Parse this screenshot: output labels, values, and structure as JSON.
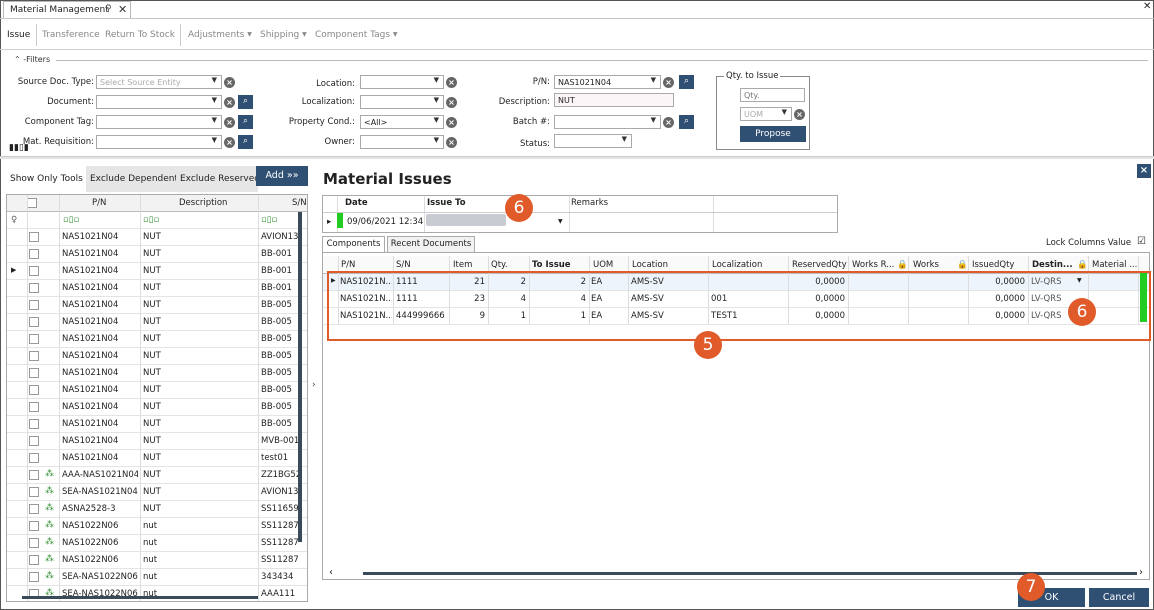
{
  "window": {
    "tab_title": "Material Management",
    "close": "✕"
  },
  "menu": {
    "items": [
      "Issue",
      "Transference",
      "Return To Stock",
      "Adjustments",
      "Shipping",
      "Component Tags"
    ]
  },
  "filters": {
    "legend": "Filters",
    "source_doc_type": {
      "label": "Source Doc. Type:",
      "placeholder": "Select Source Entity"
    },
    "document": {
      "label": "Document:"
    },
    "component_tag": {
      "label": "Component Tag:"
    },
    "mat_requisition": {
      "label": "Mat. Requisition:"
    },
    "location": {
      "label": "Location:"
    },
    "localization": {
      "label": "Localization:"
    },
    "property_cond": {
      "label": "Property Cond.:",
      "value": "<All>"
    },
    "owner": {
      "label": "Owner:"
    },
    "pn": {
      "label": "P/N:",
      "value": "NAS1021N04"
    },
    "description": {
      "label": "Description:",
      "value": "NUT"
    },
    "batch": {
      "label": "Batch #:"
    },
    "status": {
      "label": "Status:"
    },
    "qty_to_issue": {
      "title": "Qty. to Issue",
      "qty_placeholder": "Qty.",
      "uom_placeholder": "UOM",
      "propose": "Propose"
    }
  },
  "left_panel": {
    "tabs": [
      "Show Only Tools",
      "Exclude Dependent",
      "Exclude Reserved"
    ],
    "add_button": "Add »»",
    "columns": [
      "P/N",
      "Description",
      "S/N"
    ],
    "rows": [
      {
        "pn": "NAS1021N04",
        "desc": "NUT",
        "sn": "AVION13",
        "tree": false
      },
      {
        "pn": "NAS1021N04",
        "desc": "NUT",
        "sn": "BB-001",
        "tree": false
      },
      {
        "pn": "NAS1021N04",
        "desc": "NUT",
        "sn": "BB-001",
        "tree": false
      },
      {
        "pn": "NAS1021N04",
        "desc": "NUT",
        "sn": "BB-001",
        "tree": false
      },
      {
        "pn": "NAS1021N04",
        "desc": "NUT",
        "sn": "BB-005",
        "tree": false
      },
      {
        "pn": "NAS1021N04",
        "desc": "NUT",
        "sn": "BB-005",
        "tree": false
      },
      {
        "pn": "NAS1021N04",
        "desc": "NUT",
        "sn": "BB-005",
        "tree": false
      },
      {
        "pn": "NAS1021N04",
        "desc": "NUT",
        "sn": "BB-005",
        "tree": false
      },
      {
        "pn": "NAS1021N04",
        "desc": "NUT",
        "sn": "BB-005",
        "tree": false
      },
      {
        "pn": "NAS1021N04",
        "desc": "NUT",
        "sn": "BB-005",
        "tree": false
      },
      {
        "pn": "NAS1021N04",
        "desc": "NUT",
        "sn": "BB-005",
        "tree": false
      },
      {
        "pn": "NAS1021N04",
        "desc": "NUT",
        "sn": "BB-005",
        "tree": false
      },
      {
        "pn": "NAS1021N04",
        "desc": "NUT",
        "sn": "MVB-001",
        "tree": false
      },
      {
        "pn": "NAS1021N04",
        "desc": "NUT",
        "sn": "test01",
        "tree": false
      },
      {
        "pn": "AAA-NAS1021N04",
        "desc": "NUT",
        "sn": "ZZ1BG52",
        "tree": true
      },
      {
        "pn": "SEA-NAS1021N04",
        "desc": "NUT",
        "sn": "AVION13",
        "tree": true
      },
      {
        "pn": "ASNA2528-3",
        "desc": "NUT",
        "sn": "SS11659",
        "tree": true
      },
      {
        "pn": "NAS1022N06",
        "desc": "nut",
        "sn": "SS11287",
        "tree": true
      },
      {
        "pn": "NAS1022N06",
        "desc": "nut",
        "sn": "SS11287",
        "tree": true
      },
      {
        "pn": "NAS1022N06",
        "desc": "nut",
        "sn": "SS11287",
        "tree": true
      },
      {
        "pn": "SEA-NAS1022N06",
        "desc": "nut",
        "sn": "343434",
        "tree": true
      },
      {
        "pn": "SEA-NAS1022N06",
        "desc": "nut",
        "sn": "AAA111",
        "tree": true
      }
    ]
  },
  "issues": {
    "title": "Material Issues",
    "columns": [
      "Date",
      "Issue To",
      "Remarks"
    ],
    "row": {
      "date": "09/06/2021 12:34"
    }
  },
  "components": {
    "tabs": [
      "Components",
      "Recent Documents"
    ],
    "lock_label": "Lock Columns Value",
    "columns": [
      "P/N",
      "S/N",
      "Item",
      "Qty.",
      "To Issue",
      "UOM",
      "Location",
      "Localization",
      "ReservedQty",
      "Works R...",
      "Works",
      "IssuedQty",
      "Destin...",
      "Material ..."
    ],
    "rows": [
      {
        "pn": "NAS1021N...",
        "sn": "1111",
        "item": "21",
        "qty": "2",
        "to_issue": "2",
        "uom": "EA",
        "location": "AMS-SV",
        "localization": "",
        "reserved": "0,0000",
        "issued": "0,0000",
        "dest": "LV-QRS"
      },
      {
        "pn": "NAS1021N...",
        "sn": "1111",
        "item": "23",
        "qty": "4",
        "to_issue": "4",
        "uom": "EA",
        "location": "AMS-SV",
        "localization": "001",
        "reserved": "0,0000",
        "issued": "0,0000",
        "dest": "LV-QRS"
      },
      {
        "pn": "NAS1021N...",
        "sn": "444999666",
        "item": "9",
        "qty": "1",
        "to_issue": "1",
        "uom": "EA",
        "location": "AMS-SV",
        "localization": "TEST1",
        "reserved": "0,0000",
        "issued": "0,0000",
        "dest": "LV-QRS"
      }
    ]
  },
  "annotations": {
    "b6a": "6",
    "b6b": "6",
    "b5": "5",
    "b7": "7"
  },
  "buttons": {
    "ok": "OK",
    "cancel": "Cancel"
  },
  "colors": {
    "accent": "#2f4f73",
    "annotation": "#e05a2a",
    "status_green": "#22cc22"
  }
}
